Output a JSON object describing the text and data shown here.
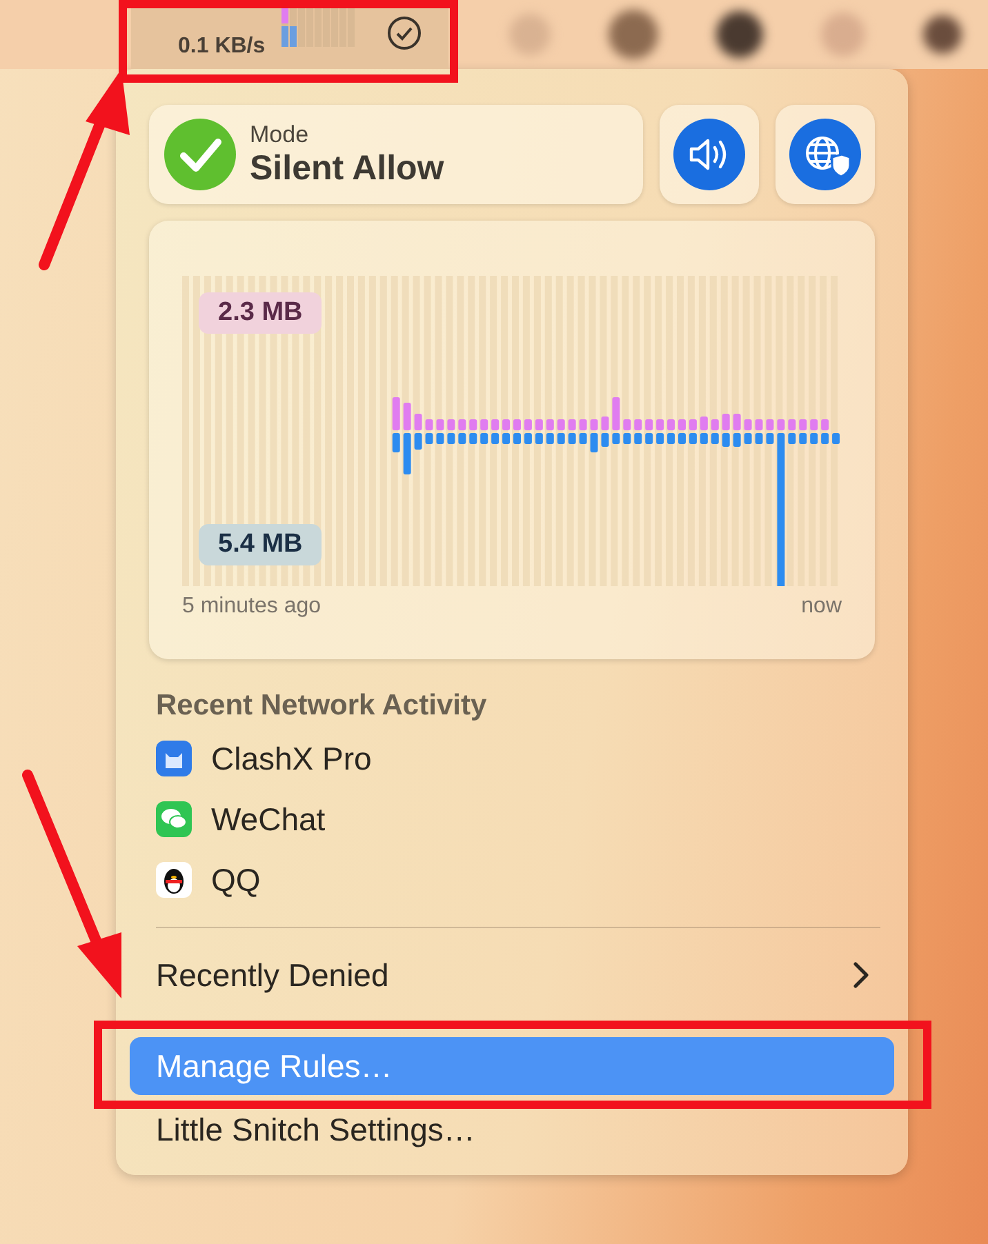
{
  "menubar": {
    "download_rate": "0.1 KB/s"
  },
  "mode": {
    "label": "Mode",
    "value": "Silent Allow"
  },
  "traffic": {
    "upload_total": "2.3 MB",
    "download_total": "5.4 MB",
    "start_label": "5 minutes ago",
    "end_label": "now"
  },
  "recent": {
    "title": "Recent Network Activity",
    "apps": [
      {
        "name": "ClashX Pro",
        "kind": "clashx"
      },
      {
        "name": "WeChat",
        "kind": "wechat"
      },
      {
        "name": "QQ",
        "kind": "qq"
      }
    ]
  },
  "menu_items": [
    {
      "label": "Recently Denied",
      "submenu": true,
      "selected": false
    },
    {
      "label": "Manage Rules…",
      "submenu": false,
      "selected": true
    },
    {
      "label": "Little Snitch Settings…",
      "submenu": false,
      "selected": false
    }
  ]
}
